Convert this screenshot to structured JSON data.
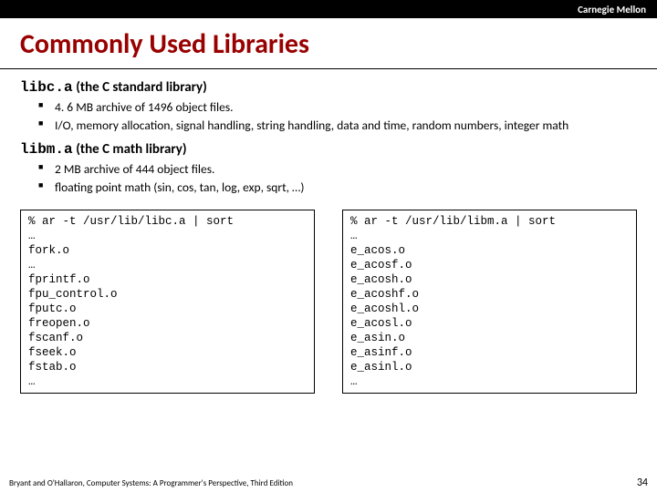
{
  "header": {
    "brand": "Carnegie Mellon"
  },
  "title": "Commonly Used Libraries",
  "libs": [
    {
      "name": "libc.a",
      "desc": "(the C standard library)",
      "bullets": [
        "4. 6 MB archive of 1496 object files.",
        "I/O, memory allocation, signal handling, string handling, data and time, random numbers, integer math"
      ]
    },
    {
      "name": "libm.a",
      "desc": "(the C math library)",
      "bullets": [
        "2 MB archive of 444 object files.",
        "floating point math (sin, cos, tan, log, exp, sqrt, …)"
      ]
    }
  ],
  "code": {
    "left": "% ar -t /usr/lib/libc.a | sort\n…\nfork.o\n…\nfprintf.o\nfpu_control.o\nfputc.o\nfreopen.o\nfscanf.o\nfseek.o\nfstab.o\n…",
    "right": "% ar -t /usr/lib/libm.a | sort\n…\ne_acos.o\ne_acosf.o\ne_acosh.o\ne_acoshf.o\ne_acoshl.o\ne_acosl.o\ne_asin.o\ne_asinf.o\ne_asinl.o\n…"
  },
  "footer": {
    "attribution": "Bryant and O'Hallaron, Computer Systems: A Programmer's Perspective, Third Edition",
    "page": "34"
  }
}
